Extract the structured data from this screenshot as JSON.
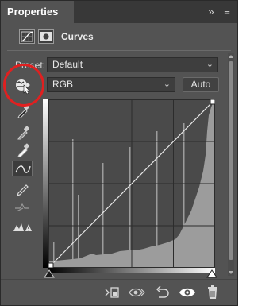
{
  "window": {
    "tab_title": "Properties",
    "more_glyph": "»",
    "menu_glyph": "≡"
  },
  "adjustment": {
    "label": "Curves",
    "icons": [
      "curves-adjustment-icon",
      "layer-mask-icon"
    ]
  },
  "preset": {
    "label": "Preset:",
    "value": "Default"
  },
  "channel": {
    "value": "RGB"
  },
  "auto_button": {
    "label": "Auto"
  },
  "tools": [
    "target-adjust-icon",
    "sample-black-point-icon",
    "sample-gray-point-icon",
    "sample-white-point-icon",
    "edit-points-curve-icon",
    "draw-curve-icon",
    "smooth-curve-icon",
    "clipping-warning-icon"
  ],
  "bottom_bar_icons": [
    "clip-to-layer-icon",
    "view-previous-state-icon",
    "reset-icon",
    "visibility-eye-icon",
    "trash-icon"
  ],
  "colors": {
    "panel_bg": "#535353",
    "graph_bg": "#4a4a4a",
    "histogram": "#9c9c9c",
    "highlight_circle": "#e02020"
  }
}
